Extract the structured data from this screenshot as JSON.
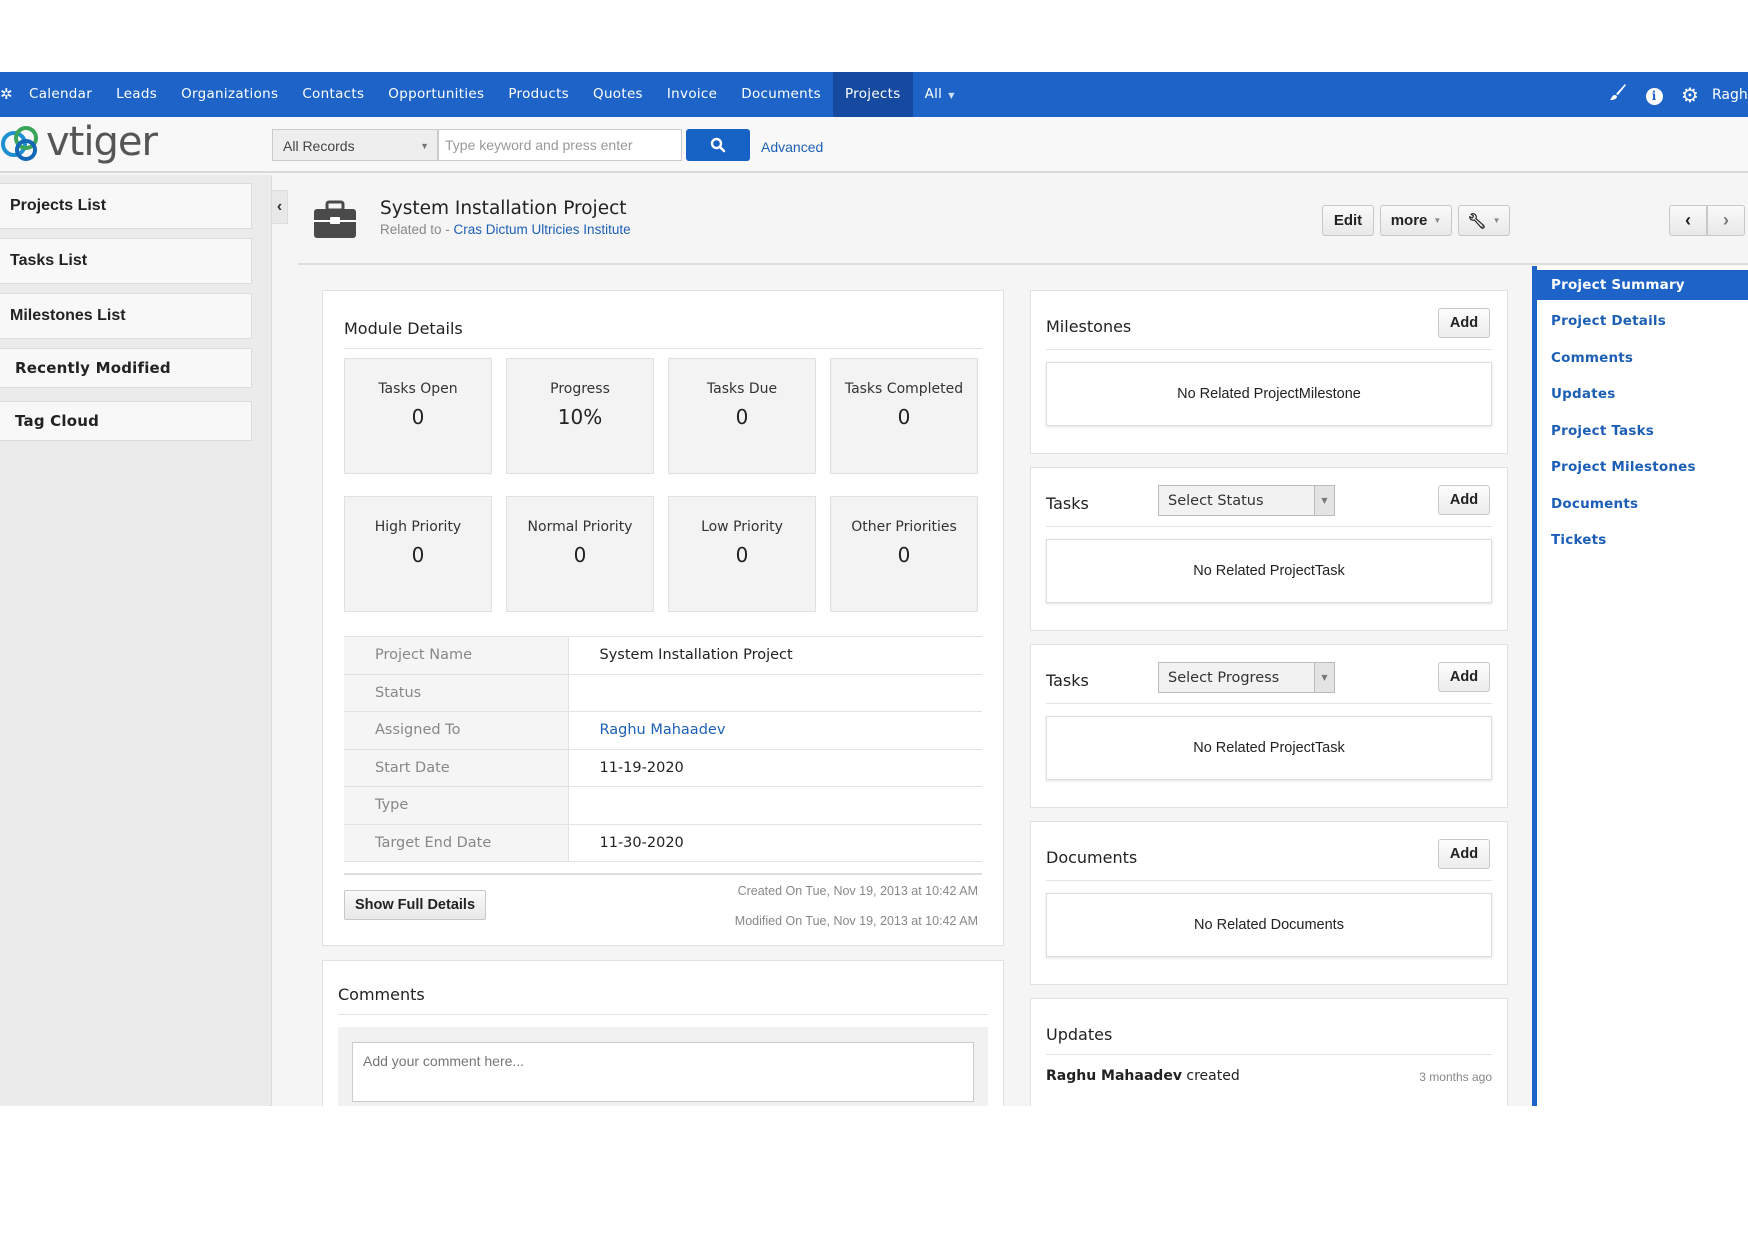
{
  "nav": {
    "menu": [
      {
        "label": "Calendar",
        "active": false
      },
      {
        "label": "Leads",
        "active": false
      },
      {
        "label": "Organizations",
        "active": false
      },
      {
        "label": "Contacts",
        "active": false
      },
      {
        "label": "Opportunities",
        "active": false
      },
      {
        "label": "Products",
        "active": false
      },
      {
        "label": "Quotes",
        "active": false
      },
      {
        "label": "Invoice",
        "active": false
      },
      {
        "label": "Documents",
        "active": false
      },
      {
        "label": "Projects",
        "active": true
      },
      {
        "label": "All",
        "active": false
      }
    ],
    "user": "Ragh",
    "brand_color": "#1e64c8",
    "icons": [
      "brush-icon",
      "info-icon",
      "settings-gear-icon"
    ]
  },
  "logo": {
    "text": "vtiger"
  },
  "search": {
    "records_select": "All Records",
    "placeholder": "Type keyword and press enter",
    "advanced": "Advanced"
  },
  "sidebar": {
    "items": [
      "Projects List",
      "Tasks List",
      "Milestones List"
    ],
    "widgets": [
      "Recently Modified",
      "Tag Cloud"
    ]
  },
  "record": {
    "title": "System Installation Project",
    "related_prefix": "Related to - ",
    "related_link": "Cras Dictum Ultricies Institute",
    "buttons": {
      "edit": "Edit",
      "more": "more"
    }
  },
  "module_details": {
    "title": "Module Details",
    "stats": [
      {
        "label": "Tasks Open",
        "value": "0"
      },
      {
        "label": "Progress",
        "value": "10%"
      },
      {
        "label": "Tasks Due",
        "value": "0"
      },
      {
        "label": "Tasks Completed",
        "value": "0"
      },
      {
        "label": "High Priority",
        "value": "0"
      },
      {
        "label": "Normal Priority",
        "value": "0"
      },
      {
        "label": "Low Priority",
        "value": "0"
      },
      {
        "label": "Other Priorities",
        "value": "0"
      }
    ],
    "fields": [
      {
        "label": "Project Name",
        "value": "System Installation Project"
      },
      {
        "label": "Status",
        "value": ""
      },
      {
        "label": "Assigned To",
        "value": "Raghu Mahaadev"
      },
      {
        "label": "Start Date",
        "value": "11-19-2020"
      },
      {
        "label": "Type",
        "value": ""
      },
      {
        "label": "Target End Date",
        "value": "11-30-2020"
      }
    ],
    "show_full": "Show Full Details",
    "created": "Created On Tue, Nov 19, 2013 at 10:42 AM",
    "modified": "Modified On Tue, Nov 19, 2013 at 10:42 AM"
  },
  "comments": {
    "title": "Comments",
    "placeholder": "Add your comment here..."
  },
  "widgets": {
    "milestones": {
      "title": "Milestones",
      "add": "Add",
      "empty": "No Related ProjectMilestone"
    },
    "tasks_status": {
      "title": "Tasks",
      "select": "Select Status",
      "add": "Add",
      "empty": "No Related ProjectTask"
    },
    "tasks_progress": {
      "title": "Tasks",
      "select": "Select Progress",
      "add": "Add",
      "empty": "No Related ProjectTask"
    },
    "documents": {
      "title": "Documents",
      "add": "Add",
      "empty": "No Related Documents"
    },
    "updates": {
      "title": "Updates",
      "user": "Raghu Mahaadev",
      "action": " created",
      "time": "3 months ago"
    }
  },
  "right_nav": {
    "items": [
      "Project Summary",
      "Project Details",
      "Comments",
      "Updates",
      "Project Tasks",
      "Project Milestones",
      "Documents",
      "Tickets"
    ],
    "active": "Project Summary"
  }
}
